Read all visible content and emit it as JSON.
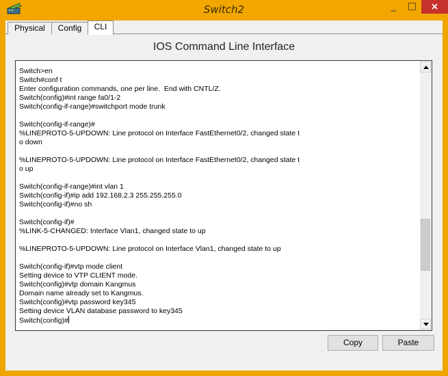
{
  "window": {
    "title": "Switch2",
    "controls": {
      "minimize": "_",
      "maximize": "□",
      "close": "×"
    }
  },
  "tabs": [
    {
      "label": "Physical"
    },
    {
      "label": "Config"
    },
    {
      "label": "CLI",
      "active": true
    }
  ],
  "cli": {
    "heading": "IOS Command Line Interface",
    "output_lines": [
      "Switch>en",
      "Switch#conf t",
      "Enter configuration commands, one per line.  End with CNTL/Z.",
      "Switch(config)#int range fa0/1-2",
      "Switch(config-if-range)#switchport mode trunk",
      "",
      "Switch(config-if-range)#",
      "%LINEPROTO-5-UPDOWN: Line protocol on Interface FastEthernet0/2, changed state t",
      "o down",
      "",
      "%LINEPROTO-5-UPDOWN: Line protocol on Interface FastEthernet0/2, changed state t",
      "o up",
      "",
      "Switch(config-if-range)#int vlan 1",
      "Switch(config-if)#ip add 192.168.2.3 255.255.255.0",
      "Switch(config-if)#no sh",
      "",
      "Switch(config-if)#",
      "%LINK-5-CHANGED: Interface Vlan1, changed state to up",
      "",
      "%LINEPROTO-5-UPDOWN: Line protocol on Interface Vlan1, changed state to up",
      "",
      "Switch(config-if)#vtp mode client",
      "Setting device to VTP CLIENT mode.",
      "Switch(config)#vtp domain Kangmus",
      "Domain name already set to Kangmus.",
      "Switch(config)#vtp password key345",
      "Setting device VLAN database password to key345"
    ],
    "prompt": "Switch(config)#"
  },
  "buttons": {
    "copy": "Copy",
    "paste": "Paste"
  },
  "colors": {
    "titlebar": "#f2a700",
    "close": "#c7312b"
  },
  "icons": {
    "app": "packet-tracer-switch-icon",
    "scroll_up": "arrow-up-icon",
    "scroll_down": "arrow-down-icon"
  }
}
